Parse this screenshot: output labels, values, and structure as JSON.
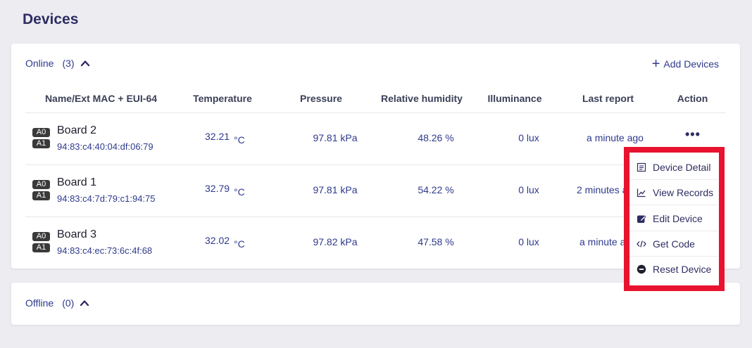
{
  "page": {
    "title": "Devices"
  },
  "online": {
    "label": "Online",
    "count": "(3)",
    "add_label": "Add Devices",
    "columns": [
      "Name/Ext MAC + EUI-64",
      "Temperature",
      "Pressure",
      "Relative humidity",
      "Illuminance",
      "Last report",
      "Action"
    ],
    "rows": [
      {
        "badge1": "A0",
        "badge2": "A1",
        "name": "Board 2",
        "mac": "94:83:c4:40:04:df:06:79",
        "temperature": "32.21",
        "temp_unit": "°C",
        "pressure": "97.81 kPa",
        "humidity": "48.26 %",
        "illuminance": "0 lux",
        "last_report": "a minute ago"
      },
      {
        "badge1": "A0",
        "badge2": "A1",
        "name": "Board 1",
        "mac": "94:83:c4:7d:79:c1:94:75",
        "temperature": "32.79",
        "temp_unit": "°C",
        "pressure": "97.81 kPa",
        "humidity": "54.22 %",
        "illuminance": "0 lux",
        "last_report": "2 minutes a"
      },
      {
        "badge1": "A0",
        "badge2": "A1",
        "name": "Board 3",
        "mac": "94:83:c4:ec:73:6c:4f:68",
        "temperature": "32.02",
        "temp_unit": "°C",
        "pressure": "97.82 kPa",
        "humidity": "47.58 %",
        "illuminance": "0 lux",
        "last_report": "a minute a"
      }
    ],
    "action_label": "•••"
  },
  "offline": {
    "label": "Offline",
    "count": "(0)"
  },
  "action_menu": {
    "items": [
      {
        "label": "Device Detail",
        "icon": "document-icon"
      },
      {
        "label": "View Records",
        "icon": "chart-line-icon"
      },
      {
        "label": "Edit Device",
        "icon": "edit-icon"
      },
      {
        "label": "Get Code",
        "icon": "code-icon"
      },
      {
        "label": "Reset Device",
        "icon": "minus-circle-icon"
      }
    ],
    "highlight_color": "#e8132e"
  }
}
